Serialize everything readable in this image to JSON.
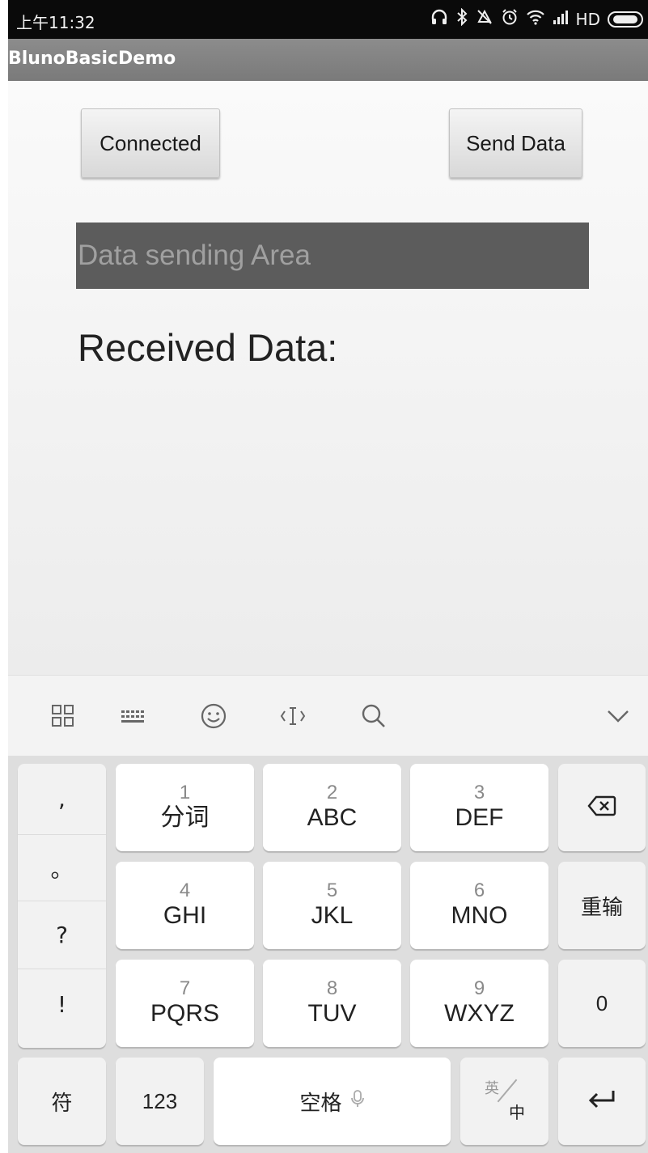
{
  "status_bar": {
    "time": "上午11:32",
    "network_label": "HD"
  },
  "app": {
    "title": "BlunoBasicDemo"
  },
  "content": {
    "connected_button": "Connected",
    "send_button": "Send Data",
    "data_input_placeholder": "Data sending Area",
    "received_label": "Received Data:"
  },
  "keyboard": {
    "toolbar_icons": [
      "grid-icon",
      "keyboard-icon",
      "emoji-icon",
      "cursor-icon",
      "search-icon",
      "chevron-down-icon"
    ],
    "punctuation": [
      ",",
      "。",
      "?",
      "!"
    ],
    "keys": [
      {
        "num": "1",
        "letters": "分词"
      },
      {
        "num": "2",
        "letters": "ABC"
      },
      {
        "num": "3",
        "letters": "DEF"
      },
      {
        "num": "4",
        "letters": "GHI"
      },
      {
        "num": "5",
        "letters": "JKL"
      },
      {
        "num": "6",
        "letters": "MNO"
      },
      {
        "num": "7",
        "letters": "PQRS"
      },
      {
        "num": "8",
        "letters": "TUV"
      },
      {
        "num": "9",
        "letters": "WXYZ"
      }
    ],
    "reset_key": "重输",
    "zero_key": "0",
    "symbol_key": "符",
    "numeric_key": "123",
    "space_key": "空格",
    "lang_en": "英",
    "lang_zh": "中"
  }
}
